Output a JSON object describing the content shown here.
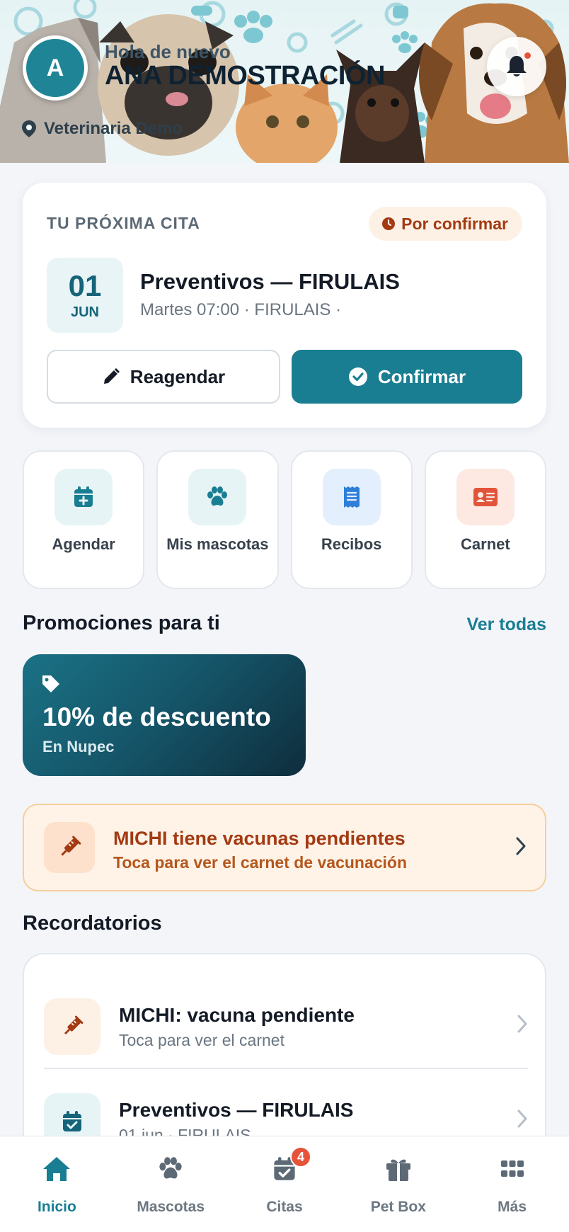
{
  "header": {
    "avatar_initial": "A",
    "greeting": "Hola de nuevo",
    "user_name": "ANA DEMOSTRACIÓN",
    "clinic_name": "Veterinaria Demo",
    "notification_dot_color": "#e5533a"
  },
  "next_appointment": {
    "heading": "TU PRÓXIMA CITA",
    "status": "Por confirmar",
    "date_day": "01",
    "date_month": "JUN",
    "title": "Preventivos — FIRULAIS",
    "subtitle": "Martes 07:00 · FIRULAIS ·",
    "reschedule_label": "Reagendar",
    "confirm_label": "Confirmar"
  },
  "quick_actions": [
    {
      "label": "Agendar",
      "icon": "calendar-plus-icon",
      "bg": "#e7f4f6",
      "color": "#1a7e93"
    },
    {
      "label": "Mis mascotas",
      "icon": "paw-icon",
      "bg": "#e7f4f6",
      "color": "#1a7e93"
    },
    {
      "label": "Recibos",
      "icon": "receipt-icon",
      "bg": "#e4effd",
      "color": "#2f7fd9"
    },
    {
      "label": "Carnet",
      "icon": "id-card-icon",
      "bg": "#fde8e2",
      "color": "#e2543a"
    }
  ],
  "promotions": {
    "title": "Promociones para ti",
    "see_all_label": "Ver todas",
    "items": [
      {
        "title": "10% de descuento",
        "subtitle": "En Nupec"
      }
    ]
  },
  "vaccine_alert": {
    "title": "MICHI tiene vacunas pendientes",
    "subtitle": "Toca para ver el carnet de vacunación"
  },
  "reminders": {
    "title": "Recordatorios",
    "items": [
      {
        "title": "MICHI: vacuna pendiente",
        "subtitle": "Toca para ver el carnet",
        "icon": "syringe-icon"
      },
      {
        "title": "Preventivos — FIRULAIS",
        "subtitle": "01 jun · FIRULAIS",
        "icon": "calendar-check-icon"
      }
    ]
  },
  "bottom_nav": {
    "items": [
      {
        "label": "Inicio",
        "icon": "home-icon",
        "active": true
      },
      {
        "label": "Mascotas",
        "icon": "paw-icon"
      },
      {
        "label": "Citas",
        "icon": "calendar-check-icon",
        "badge": "4"
      },
      {
        "label": "Pet Box",
        "icon": "gift-icon"
      },
      {
        "label": "Más",
        "icon": "grid-icon"
      }
    ]
  },
  "colors": {
    "primary": "#1a7e93",
    "warning_text": "#a33a12",
    "background": "#f3f5f9"
  }
}
